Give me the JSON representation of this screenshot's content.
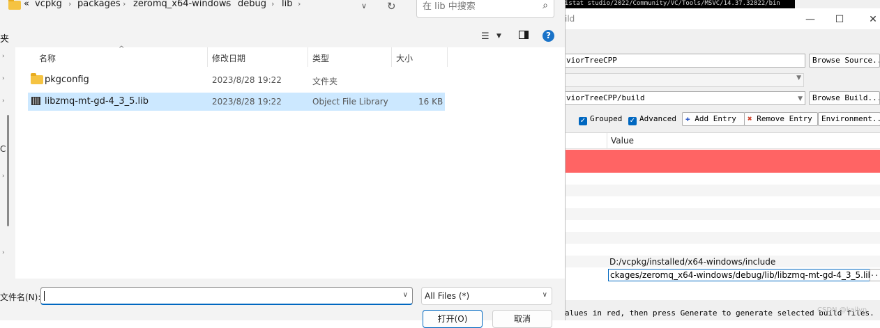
{
  "dialog": {
    "breadcrumb": {
      "overflow": "«",
      "segments": [
        "vcpkg",
        "packages",
        "zeromq_x64-windows",
        "debug",
        "lib"
      ]
    },
    "search_placeholder": "在 lib 中搜索",
    "nav_cut_label": "夹",
    "nav_letter": "C",
    "columns": {
      "name": "名称",
      "date": "修改日期",
      "type": "类型",
      "size": "大小"
    },
    "files": [
      {
        "name": "pkgconfig",
        "date": "2023/8/28 19:22",
        "type": "文件夹",
        "size": "",
        "icon": "folder-icon"
      },
      {
        "name": "libzmq-mt-gd-4_3_5.lib",
        "date": "2023/8/28 19:22",
        "type": "Object File Library",
        "size": "16 KB",
        "icon": "library-file-icon",
        "selected": true
      }
    ],
    "filename_label": "文件名(N):",
    "filename_value": "",
    "filter_value": "All Files  (*)",
    "open_button": "打开(O)",
    "cancel_button": "取消"
  },
  "cmake": {
    "path_strip": "istat studio/2022/Community/VC/Tools/MSVC/14.37.32822/bin",
    "title_fragment": "ild",
    "source_value": "viorTreeCPP",
    "build_value": "viorTreeCPP/build",
    "browse_source": "Browse Source...",
    "browse_build": "Browse Build...",
    "grouped": "Grouped",
    "advanced": "Advanced",
    "add_entry": "Add Entry",
    "remove_entry": "Remove Entry",
    "environment": "Environment...",
    "value_header": "Value",
    "include_value": "D:/vcpkg/installed/x64-windows/include",
    "lib_value": "ckages/zeromq_x64-windows/debug/lib/libzmq-mt-gd-4_3_5.lib",
    "lib_more": "...",
    "status_text": "alues in red, then press Generate to generate selected build files.",
    "watermark": "CSDN @kailvn",
    "row_colors": {
      "highlight": "#ff6464"
    }
  }
}
